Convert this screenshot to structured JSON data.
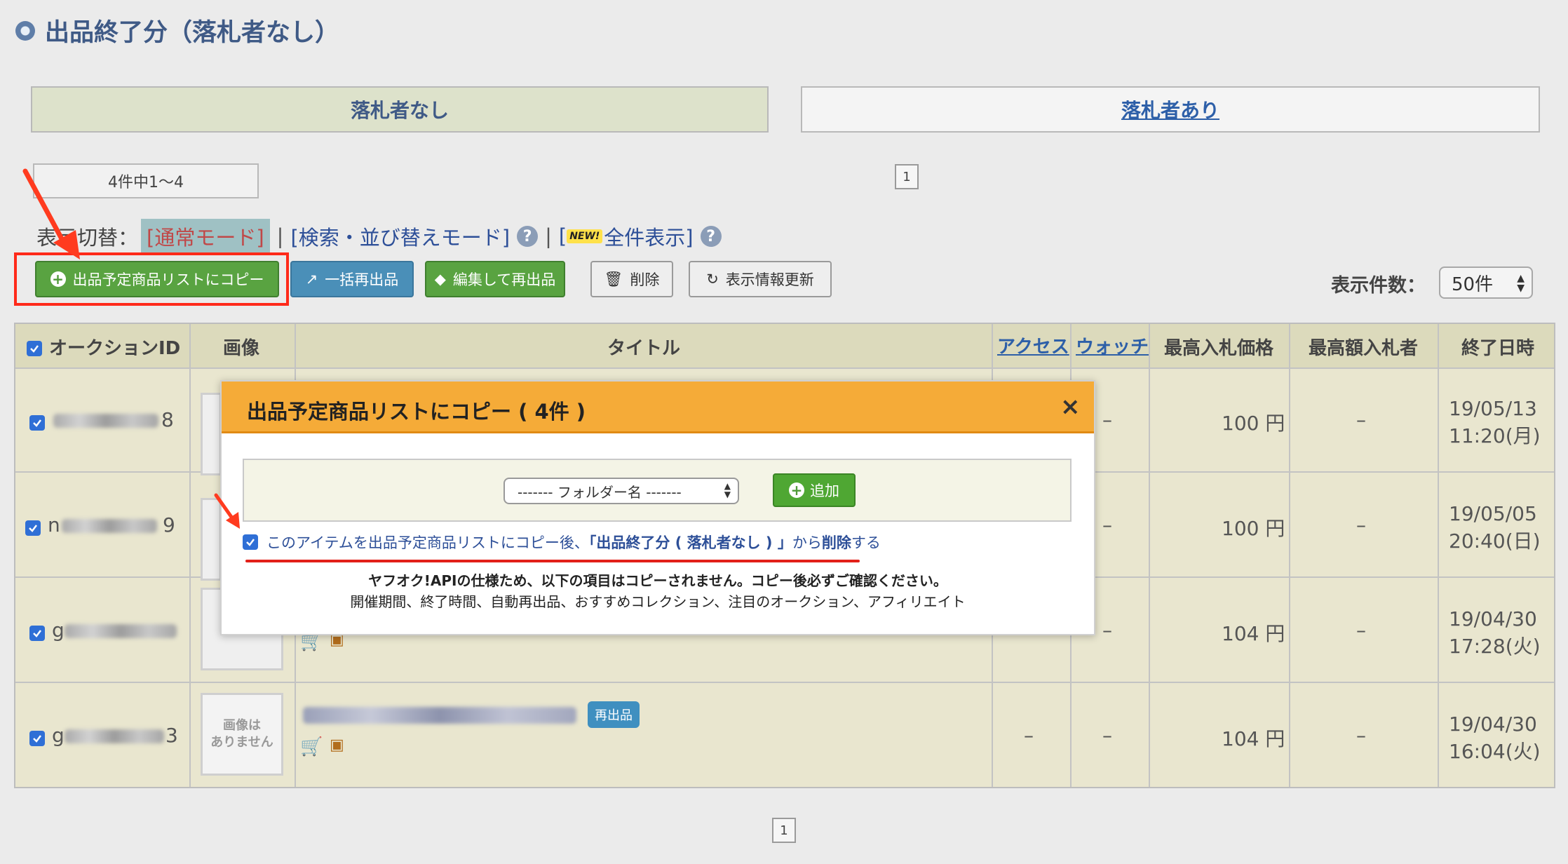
{
  "header": {
    "title": "出品終了分（落札者なし）"
  },
  "tabs": {
    "active": "落札者なし",
    "inactive": "落札者あり"
  },
  "pager": {
    "count_text": "4件中1〜4",
    "page": "1"
  },
  "mode": {
    "label": "表示切替：",
    "current": "[通常モード]",
    "sep": "|",
    "search_mode": "[検索・並び替えモード]",
    "all_bracket_open": "[",
    "new_badge": "NEW!",
    "all_view": "全件表示]",
    "help": "?"
  },
  "toolbar": {
    "copy_label": "出品予定商品リストにコピー",
    "bulk_relist_label": "一括再出品",
    "edit_relist_label": "編集して再出品",
    "delete_label": "削除",
    "refresh_label": "表示情報更新",
    "display_count_label": "表示件数：",
    "display_count_value": "50件"
  },
  "table": {
    "headers": {
      "auction_id": "オークションID",
      "image": "画像",
      "title": "タイトル",
      "access": "アクセス",
      "watch": "ウォッチ",
      "max_bid": "最高入札価格",
      "max_bidder": "最高額入札者",
      "end_date": "終了日時"
    },
    "rows": [
      {
        "id_tail": "8",
        "access": "",
        "watch": "–",
        "price": "100 円",
        "bidder": "–",
        "date": "19/05/13",
        "time": "11:20(月)"
      },
      {
        "id_tail": "9",
        "id_head": "n",
        "access": "",
        "watch": "–",
        "price": "100 円",
        "bidder": "–",
        "date": "19/05/05",
        "time": "20:40(日)"
      },
      {
        "id_tail": "",
        "id_head": "g",
        "access": "",
        "watch": "–",
        "price": "104 円",
        "bidder": "–",
        "date": "19/04/30",
        "time": "17:28(火)"
      },
      {
        "id_tail": "3",
        "id_head": "g",
        "access": "–",
        "watch": "–",
        "price": "104 円",
        "bidder": "–",
        "date": "19/04/30",
        "time": "16:04(火)",
        "noimage_line1": "画像は",
        "noimage_line2": "ありません",
        "badge": "再出品"
      }
    ]
  },
  "modal": {
    "title": "出品予定商品リストにコピー ( 4件 )",
    "close": "×",
    "folder_placeholder": "------- フォルダー名 -------",
    "add_label": "追加",
    "check_pre": "このアイテムを出品予定商品リストにコピー後、",
    "check_bold": "「出品終了分 ( 落札者なし ) 」",
    "check_mid": "から",
    "check_bold2": "削除",
    "check_post": "する",
    "note1": "ヤフオク!APIの仕様ため、以下の項目はコピーされません。コピー後必ずご確認ください。",
    "note2": "開催期間、終了時間、自動再出品、おすすめコレクション、注目のオークション、アフィリエイト"
  },
  "colors": {
    "accent_red": "#ff2a1a",
    "modal_header": "#f5ab38",
    "button_green": "#59a341",
    "button_blue": "#4a8fb8",
    "link_blue": "#2d5fa8"
  }
}
